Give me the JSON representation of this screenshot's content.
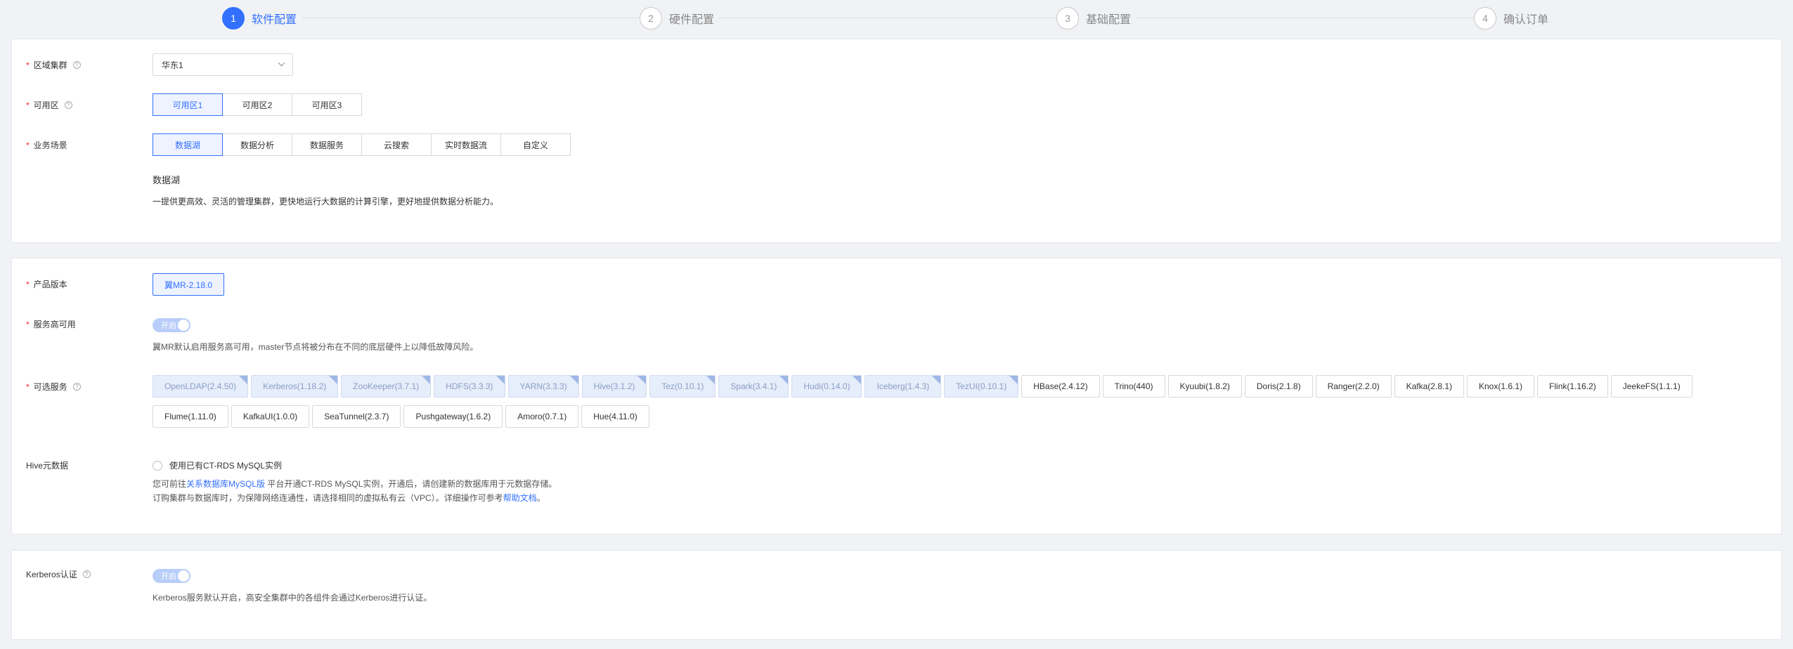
{
  "steps": [
    {
      "num": "1",
      "label": "软件配置"
    },
    {
      "num": "2",
      "label": "硬件配置"
    },
    {
      "num": "3",
      "label": "基础配置"
    },
    {
      "num": "4",
      "label": "确认订单"
    }
  ],
  "region": {
    "label": "区域集群",
    "value": "华东1"
  },
  "zone": {
    "label": "可用区",
    "options": [
      "可用区1",
      "可用区2",
      "可用区3"
    ],
    "selected": "可用区1"
  },
  "scenario": {
    "label": "业务场景",
    "options": [
      "数据湖",
      "数据分析",
      "数据服务",
      "云搜索",
      "实时数据流",
      "自定义"
    ],
    "selected": "数据湖",
    "title": "数据湖",
    "desc": "一提供更高效、灵活的管理集群，更快地运行大数据的计算引擎，更好地提供数据分析能力。"
  },
  "product": {
    "label": "产品版本",
    "value": "翼MR-2.18.0"
  },
  "ha": {
    "label": "服务高可用",
    "toggle_text": "开启",
    "desc": "翼MR默认启用服务高可用，master节点将被分布在不同的底层硬件上以降低故障风险。"
  },
  "services": {
    "label": "可选服务",
    "row1": [
      {
        "name": "OpenLDAP(2.4.50)",
        "disabled": true
      },
      {
        "name": "Kerberos(1.18.2)",
        "disabled": true
      },
      {
        "name": "ZooKeeper(3.7.1)",
        "disabled": true
      },
      {
        "name": "HDFS(3.3.3)",
        "disabled": true
      },
      {
        "name": "YARN(3.3.3)",
        "disabled": true
      },
      {
        "name": "Hive(3.1.2)",
        "disabled": true
      },
      {
        "name": "Tez(0.10.1)",
        "disabled": true
      },
      {
        "name": "Spark(3.4.1)",
        "disabled": true
      },
      {
        "name": "Hudi(0.14.0)",
        "disabled": true
      },
      {
        "name": "Iceberg(1.4.3)",
        "disabled": true
      },
      {
        "name": "TezUI(0.10.1)",
        "disabled": true
      },
      {
        "name": "HBase(2.4.12)",
        "disabled": false
      },
      {
        "name": "Trino(440)",
        "disabled": false
      },
      {
        "name": "Kyuubi(1.8.2)",
        "disabled": false
      },
      {
        "name": "Doris(2.1.8)",
        "disabled": false
      },
      {
        "name": "Ranger(2.2.0)",
        "disabled": false
      },
      {
        "name": "Kafka(2.8.1)",
        "disabled": false
      },
      {
        "name": "Knox(1.6.1)",
        "disabled": false
      },
      {
        "name": "Flink(1.16.2)",
        "disabled": false
      },
      {
        "name": "JeekeFS(1.1.1)",
        "disabled": false
      }
    ],
    "row2": [
      {
        "name": "Flume(1.11.0)",
        "disabled": false
      },
      {
        "name": "KafkaUI(1.0.0)",
        "disabled": false
      },
      {
        "name": "SeaTunnel(2.3.7)",
        "disabled": false
      },
      {
        "name": "Pushgateway(1.6.2)",
        "disabled": false
      },
      {
        "name": "Amoro(0.7.1)",
        "disabled": false
      },
      {
        "name": "Hue(4.11.0)",
        "disabled": false
      }
    ]
  },
  "hive_meta": {
    "label": "Hive元数据",
    "radio_label": "使用已有CT-RDS MySQL实例",
    "hint1_pre": "您可前往",
    "hint1_link": "关系数据库MySQL版",
    "hint1_post": " 平台开通CT-RDS MySQL实例，开通后，请创建新的数据库用于元数据存储。",
    "hint2_pre": "订购集群与数据库时，为保障网络连通性，请选择相同的虚拟私有云（VPC）。详细操作可参考",
    "hint2_link": "帮助文档",
    "hint2_post": "。"
  },
  "kerberos": {
    "label": "Kerberos认证",
    "toggle_text": "开启",
    "desc": "Kerberos服务默认开启，高安全集群中的各组件会通过Kerberos进行认证。"
  }
}
